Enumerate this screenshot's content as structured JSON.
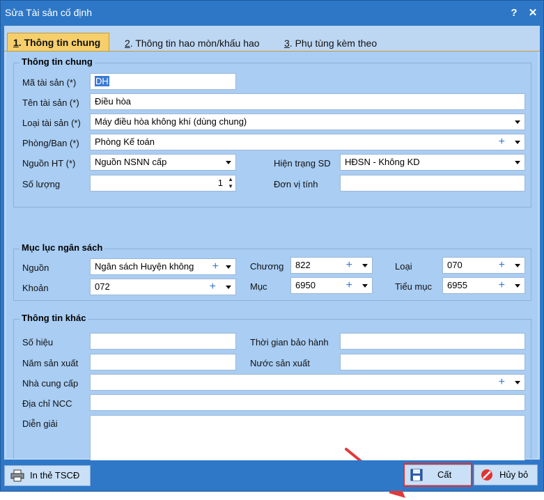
{
  "window": {
    "title": "Sửa Tài sản cố định",
    "help": "?",
    "close": "✕"
  },
  "tabs": [
    {
      "num": "1",
      "label": ". Thông tin chung"
    },
    {
      "num": "2",
      "label": ". Thông tin hao mòn/khấu hao"
    },
    {
      "num": "3",
      "label": ". Phụ tùng kèm theo"
    }
  ],
  "general": {
    "legend": "Thông tin chung",
    "asset_code_label": "Mã tài sản (*)",
    "asset_code": "DH",
    "asset_name_label": "Tên tài sản (*)",
    "asset_name": "Điều hòa",
    "asset_type_label": "Loại tài sản (*)",
    "asset_type": "Máy điều hòa không khí (dùng chung)",
    "dept_label": "Phòng/Ban (*)",
    "dept": "Phòng Kế toán",
    "source_label": "Nguồn HT (*)",
    "source": "Nguồn NSNN cấp",
    "status_label": "Hiện trạng SD",
    "status": "HĐSN - Không KD",
    "qty_label": "Số lượng",
    "qty": "1",
    "unit_label": "Đơn vị tính",
    "unit": ""
  },
  "budget": {
    "legend": "Mục lục ngân sách",
    "nguon_label": "Nguồn",
    "nguon": "Ngân sách Huyện không",
    "chuong_label": "Chương",
    "chuong": "822",
    "loai_label": "Loại",
    "loai": "070",
    "khoan_label": "Khoản",
    "khoan": "072",
    "muc_label": "Mục",
    "muc": "6950",
    "tieumuc_label": "Tiểu mục",
    "tieumuc": "6955"
  },
  "other": {
    "legend": "Thông tin khác",
    "sohieu_label": "Số hiệu",
    "sohieu": "",
    "baohanh_label": "Thời gian bảo hành",
    "baohanh": "",
    "namsx_label": "Năm sản xuất",
    "namsx": "",
    "nuocsx_label": "Nước sản xuất",
    "nuocsx": "",
    "ncc_label": "Nhà cung cấp",
    "ncc": "",
    "diachi_label": "Địa chỉ NCC",
    "diachi": "",
    "diengiai_label": "Diễn giải",
    "diengiai": ""
  },
  "footer": {
    "print": "In thẻ TSCĐ",
    "save": "Cất",
    "cancel": "Hủy bỏ"
  },
  "colors": {
    "accent_tab": "#f6cf6b",
    "highlight": "#e03030",
    "plus": "#3478d4"
  }
}
